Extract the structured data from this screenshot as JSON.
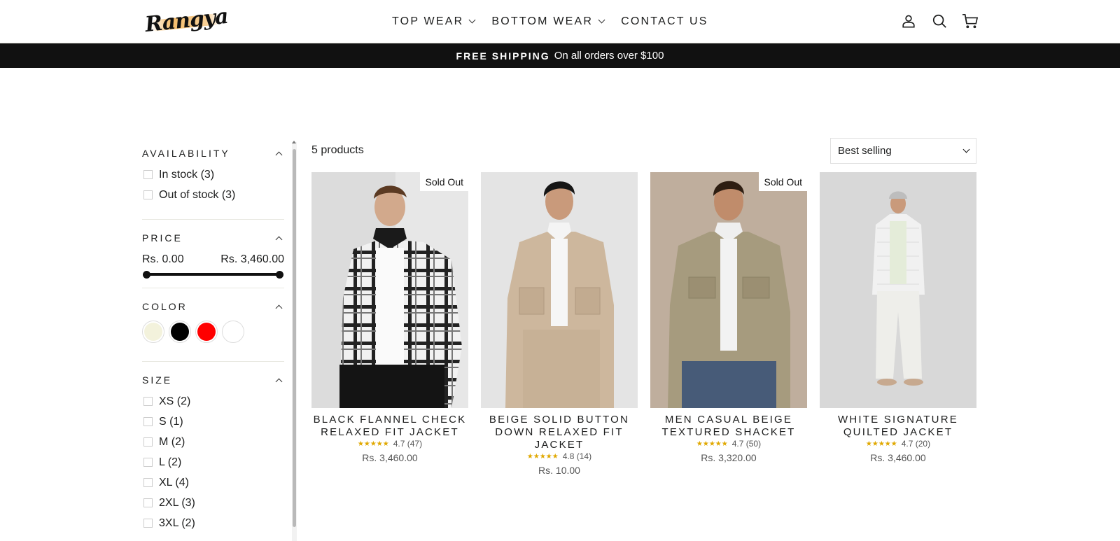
{
  "brand": {
    "logo_text": "Rangya"
  },
  "nav": {
    "items": [
      {
        "label": "TOP WEAR",
        "has_dropdown": true
      },
      {
        "label": "BOTTOM WEAR",
        "has_dropdown": true
      },
      {
        "label": "CONTACT US",
        "has_dropdown": false
      }
    ]
  },
  "header_icons": [
    "account-icon",
    "search-icon",
    "cart-icon"
  ],
  "announcement": {
    "strong": "FREE SHIPPING",
    "text": "On all orders over $100"
  },
  "filters": {
    "availability": {
      "title": "AVAILABILITY",
      "options": [
        {
          "label": "In stock (3)"
        },
        {
          "label": "Out of stock (3)"
        }
      ]
    },
    "price": {
      "title": "PRICE",
      "min_label": "Rs. 0.00",
      "max_label": "Rs. 3,460.00"
    },
    "color": {
      "title": "COLOR",
      "swatches": [
        {
          "color": "#f3f2dc"
        },
        {
          "color": "#000000"
        },
        {
          "color": "#ff0000"
        },
        {
          "color": "#ffffff"
        }
      ]
    },
    "size": {
      "title": "SIZE",
      "options": [
        {
          "label": "XS (2)"
        },
        {
          "label": "S (1)"
        },
        {
          "label": "M (2)"
        },
        {
          "label": "L (2)"
        },
        {
          "label": "XL (4)"
        },
        {
          "label": "2XL (3)"
        },
        {
          "label": "3XL (2)"
        }
      ]
    }
  },
  "results": {
    "count_label": "5 products",
    "sort_label": "Best selling"
  },
  "products": [
    {
      "title": "BLACK FLANNEL CHECK RELAXED FIT JACKET",
      "rating": "4.7 (47)",
      "stars": "★★★★★",
      "price": "Rs. 3,460.00",
      "badge": "Sold Out"
    },
    {
      "title": "BEIGE SOLID BUTTON DOWN RELAXED FIT JACKET",
      "rating": "4.8 (14)",
      "stars": "★★★★★",
      "price": "Rs. 10.00",
      "badge": ""
    },
    {
      "title": "MEN CASUAL BEIGE TEXTURED SHACKET",
      "rating": "4.7 (50)",
      "stars": "★★★★★",
      "price": "Rs. 3,320.00",
      "badge": "Sold Out"
    },
    {
      "title": "WHITE SIGNATURE QUILTED JACKET",
      "rating": "4.7 (20)",
      "stars": "★★★★★",
      "price": "Rs. 3,460.00",
      "badge": ""
    }
  ],
  "colors": {
    "accent": "#111111",
    "star": "#e0a800"
  }
}
